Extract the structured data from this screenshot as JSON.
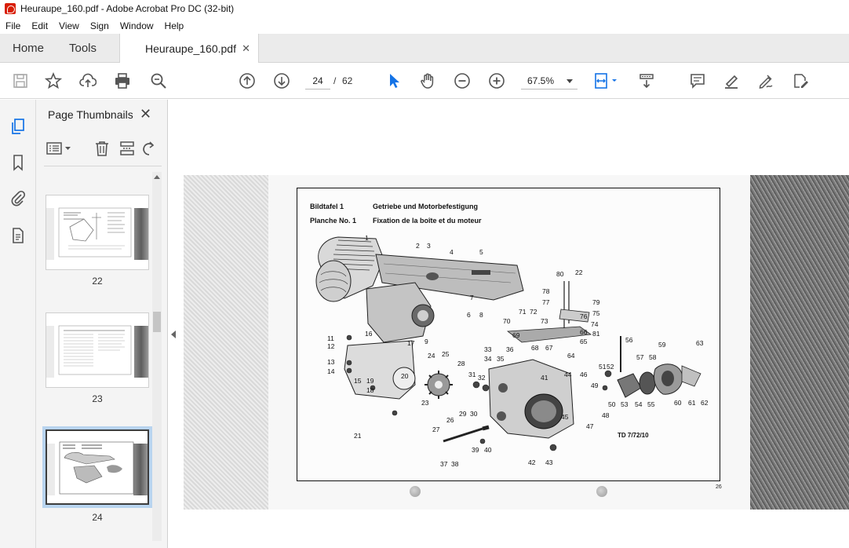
{
  "window": {
    "title": "Heuraupe_160.pdf - Adobe Acrobat Pro DC (32-bit)"
  },
  "menu": [
    "File",
    "Edit",
    "View",
    "Sign",
    "Window",
    "Help"
  ],
  "tabs": {
    "home": "Home",
    "tools": "Tools",
    "document": "Heuraupe_160.pdf",
    "close": "✕"
  },
  "toolbar": {
    "current_page": "24",
    "separator": "/",
    "total_pages": "62",
    "zoom": "67.5%"
  },
  "panel": {
    "title": "Page Thumbnails",
    "close": "✕",
    "thumbnails": [
      {
        "label": "22"
      },
      {
        "label": "23"
      },
      {
        "label": "24",
        "selected": true
      }
    ]
  },
  "document": {
    "caption_de_label": "Bildtafel 1",
    "caption_de_text": "Getriebe und Motorbefestigung",
    "caption_fr_label": "Planche No. 1",
    "caption_fr_text": "Fixation de la boîte et du moteur",
    "code": "TD 7/72/10",
    "page_number": "26",
    "parts": [
      "1",
      "2",
      "3",
      "4",
      "5",
      "6",
      "7",
      "8",
      "9",
      "11",
      "12",
      "13",
      "14",
      "15",
      "16",
      "17",
      "18",
      "19",
      "20",
      "21",
      "22",
      "23",
      "24",
      "25",
      "26",
      "27",
      "28",
      "29",
      "30",
      "31",
      "32",
      "33",
      "34",
      "35",
      "36",
      "37",
      "38",
      "39",
      "40",
      "41",
      "42",
      "43",
      "44",
      "45",
      "46",
      "47",
      "48",
      "49",
      "50",
      "51",
      "52",
      "53",
      "54",
      "55",
      "56",
      "57",
      "58",
      "59",
      "60",
      "61",
      "62",
      "63",
      "64",
      "65",
      "66",
      "67",
      "68",
      "69",
      "70",
      "71",
      "72",
      "73",
      "74",
      "75",
      "76",
      "77",
      "78",
      "79",
      "80",
      "81"
    ]
  },
  "colors": {
    "accent_blue": "#1473e6",
    "icon_gray": "#5a5a5a",
    "acrobat_red": "#d81e05"
  }
}
